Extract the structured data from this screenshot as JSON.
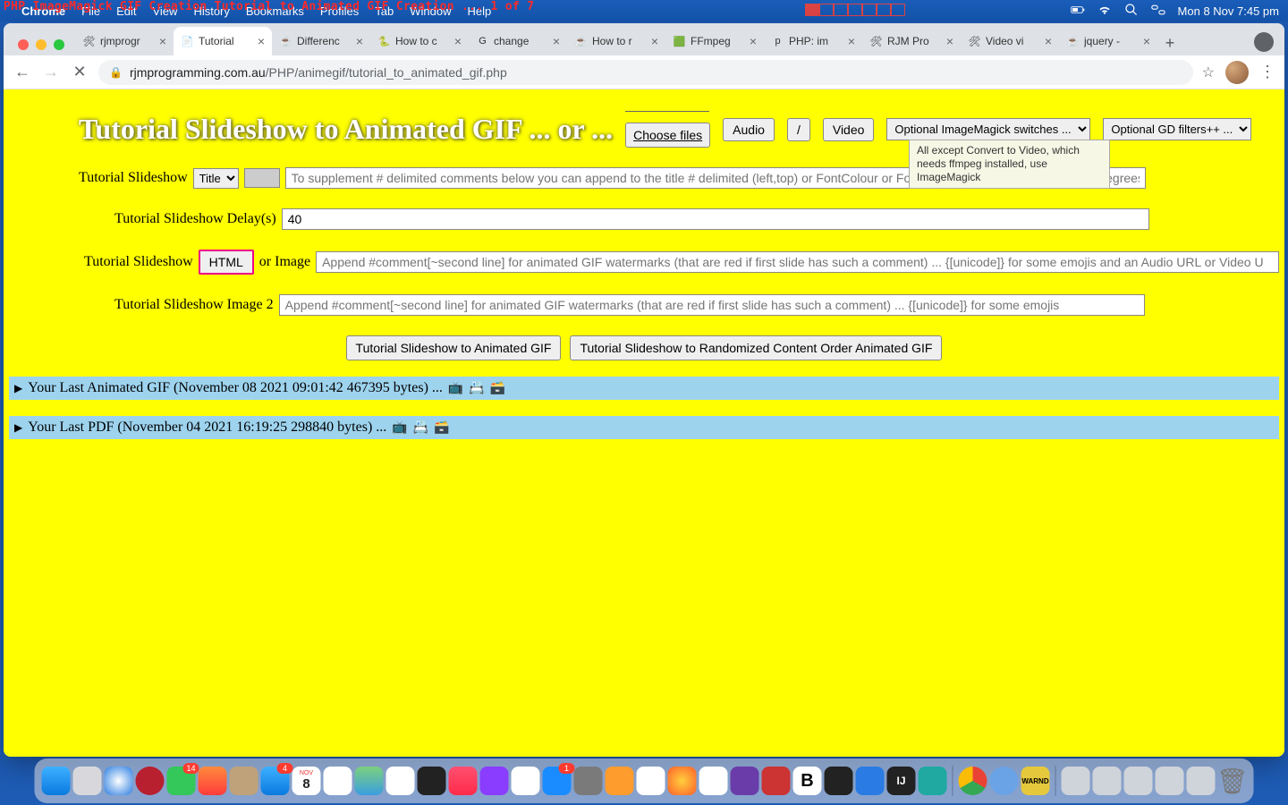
{
  "menubar": {
    "overlay_text": "PHP ImageMagick GIF Creation Tutorial to Animated GIF Creation ... 1 of 7",
    "app": "Chrome",
    "items": [
      "File",
      "Edit",
      "View",
      "History",
      "Bookmarks",
      "Profiles",
      "Tab",
      "Window",
      "Help"
    ],
    "datetime": "Mon 8 Nov  7:45 pm"
  },
  "tabs": [
    {
      "title": "rjmprogr",
      "active": false,
      "fav": "🛠"
    },
    {
      "title": "Tutorial",
      "active": true,
      "fav": "📄"
    },
    {
      "title": "Differenc",
      "active": false,
      "fav": "☕"
    },
    {
      "title": "How to c",
      "active": false,
      "fav": "🐍"
    },
    {
      "title": "change",
      "active": false,
      "fav": "G"
    },
    {
      "title": "How to r",
      "active": false,
      "fav": "☕"
    },
    {
      "title": "FFmpeg",
      "active": false,
      "fav": "🟩"
    },
    {
      "title": "PHP: im",
      "active": false,
      "fav": "p"
    },
    {
      "title": "RJM Pro",
      "active": false,
      "fav": "🛠"
    },
    {
      "title": "Video vi",
      "active": false,
      "fav": "🛠"
    },
    {
      "title": "jquery -",
      "active": false,
      "fav": "☕"
    }
  ],
  "omnibox": {
    "domain": "rjmprogramming.com.au",
    "path": "/PHP/animegif/tutorial_to_animated_gif.php"
  },
  "page": {
    "heading": "Tutorial Slideshow to Animated GIF ... or ...",
    "choose_files": "Choose files",
    "audio_btn": "Audio",
    "slash_btn": "/",
    "video_btn": "Video",
    "select_im": "Optional ImageMagick switches ... ",
    "select_gd": "Optional GD filters++ ... ",
    "tooltip": "All except Convert to Video, which needs ffmpeg installed, use ImageMagick",
    "row1_label": "Tutorial Slideshow",
    "title_select": "Title",
    "row1_placeholder": "To supplement # delimited comments below you can append to the title # delimited (left,top) or FontColour or Font_name or FontSize_px or AngleDegrees[,Opacity] conf",
    "row2_label": "Tutorial Slideshow Delay(s)",
    "row2_value": "40",
    "row3_label": "Tutorial Slideshow",
    "html_btn": "HTML",
    "row3_or": " or Image",
    "row3_placeholder": "Append #comment[~second line] for animated GIF watermarks (that are red if first slide has such a comment) ... {[unicode]} for some emojis and an Audio URL or Video U",
    "row4_label": "Tutorial Slideshow Image 2",
    "row4_placeholder": "Append #comment[~second line] for animated GIF watermarks (that are red if first slide has such a comment) ... {[unicode]} for some emojis",
    "submit1": "Tutorial Slideshow to Animated GIF",
    "submit2": "Tutorial Slideshow to Randomized Content Order Animated GIF",
    "details1": "Your Last Animated GIF (November 08 2021 09:01:42 467395 bytes) ...",
    "details2": "Your Last PDF (November 04 2021 16:19:25 298840 bytes) ..."
  },
  "dock_badges": {
    "messages": "14",
    "mail": "4",
    "cal_day": "8",
    "cal_month": "NOV",
    "appstore": "1"
  }
}
